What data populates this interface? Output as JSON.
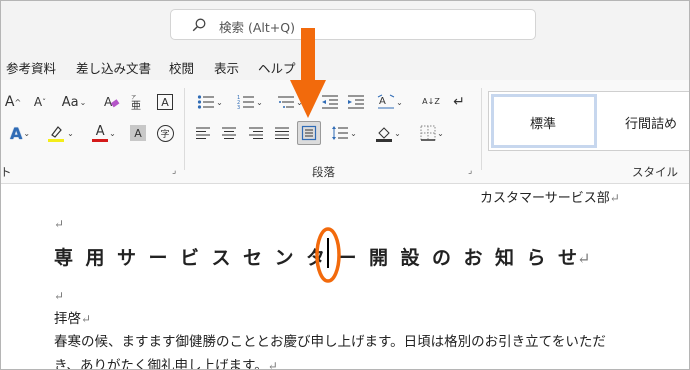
{
  "search": {
    "label": "検索 (Alt+Q)"
  },
  "menu": {
    "tabs": [
      "参考資料",
      "差し込み文書",
      "校閲",
      "表示",
      "ヘルプ"
    ]
  },
  "ribbon": {
    "font": {
      "grow_label": "A",
      "shrink_label": "A",
      "case_label": "Aa",
      "text_effect_label": "A",
      "font_color_label": "A",
      "char_shading_label": "A",
      "enclosed_char_label": "字",
      "border_char_label": "A"
    },
    "paragraph_label": "段落",
    "left_group_label_fragment": "ト",
    "sort_label": "A↓Z",
    "styles_label": "スタイル",
    "style_items": [
      "標準",
      "行間詰め"
    ]
  },
  "annotation": {
    "arrow_color": "#f26a0c",
    "ellipse_color": "#f26a0c"
  },
  "document": {
    "department": "カスタマーサービス部",
    "title_chars": [
      "専",
      "用",
      "サ",
      "ー",
      "ビ",
      "ス",
      "セ",
      "ン",
      "タ",
      "ー",
      "開",
      "設",
      "の",
      "お",
      "知",
      "ら",
      "せ"
    ],
    "salutation": "拝啓",
    "body_line1": "春寒の候、ますます御健勝のこととお慶び申し上げます。日頃は格別のお引き立てをいただ",
    "body_line2": "き、ありがたく御礼申し上げます。",
    "return_mark": "↵"
  }
}
